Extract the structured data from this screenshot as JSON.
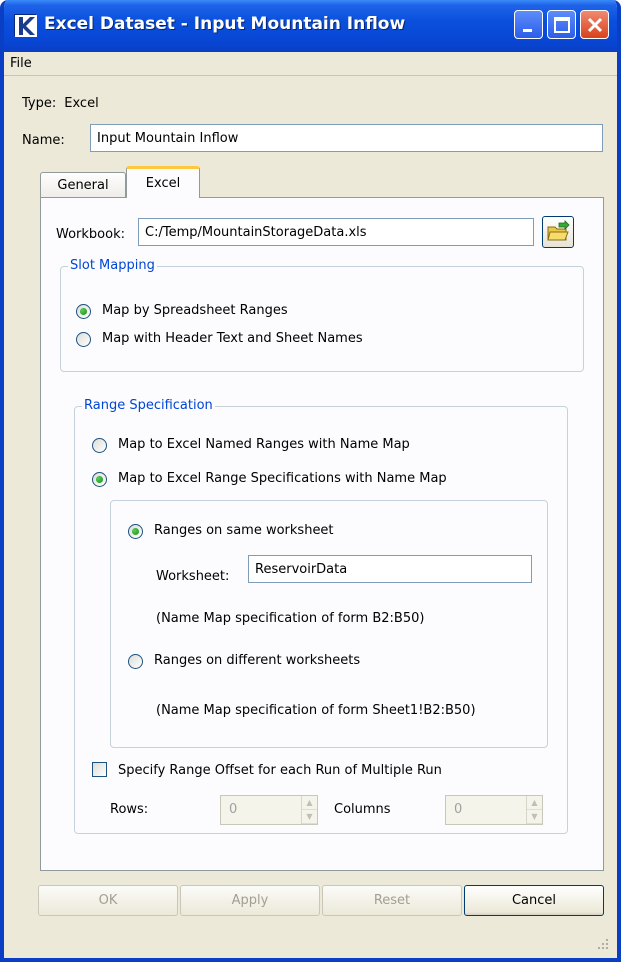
{
  "window": {
    "title": "Excel Dataset - Input Mountain Inflow",
    "title_bar_color": "#0a50dd"
  },
  "menu": {
    "file": "File"
  },
  "dataset": {
    "type_label": "Type:",
    "type_value": "Excel",
    "name_label": "Name:",
    "name_value": "Input Mountain Inflow"
  },
  "tabs": [
    {
      "label": "General",
      "selected": false
    },
    {
      "label": "Excel",
      "selected": true
    }
  ],
  "excel": {
    "workbook_label": "Workbook:",
    "workbook_value": "C:/Temp/MountainStorageData.xls",
    "slot_mapping": {
      "legend": "Slot Mapping",
      "options": [
        {
          "label": "Map by Spreadsheet Ranges",
          "selected": true
        },
        {
          "label": "Map with Header Text and Sheet Names",
          "selected": false
        }
      ]
    },
    "range_specification": {
      "legend": "Range Specification",
      "options": [
        {
          "label": "Map to Excel Named Ranges with Name Map",
          "selected": false
        },
        {
          "label": "Map to Excel Range Specifications with Name Map",
          "selected": true
        }
      ],
      "worksheet_options": {
        "same": {
          "label": "Ranges on same worksheet",
          "selected": true
        },
        "worksheet_label": "Worksheet:",
        "worksheet_value": "ReservoirData",
        "same_note": "(Name Map specification of form B2:B50)",
        "different": {
          "label": "Ranges on different worksheets",
          "selected": false
        },
        "different_note": "(Name Map specification of form Sheet1!B2:B50)"
      },
      "offset": {
        "checkbox_label": "Specify Range Offset for each Run of Multiple Run",
        "checked": false,
        "rows_label": "Rows:",
        "rows_value": "0",
        "columns_label": "Columns",
        "columns_value": "0"
      }
    }
  },
  "buttons": {
    "ok": "OK",
    "apply": "Apply",
    "reset": "Reset",
    "cancel": "Cancel"
  },
  "colors": {
    "group_legend": "#0046d5",
    "radio_selected": "#21a121",
    "tab_highlight": "#ffc83c"
  }
}
